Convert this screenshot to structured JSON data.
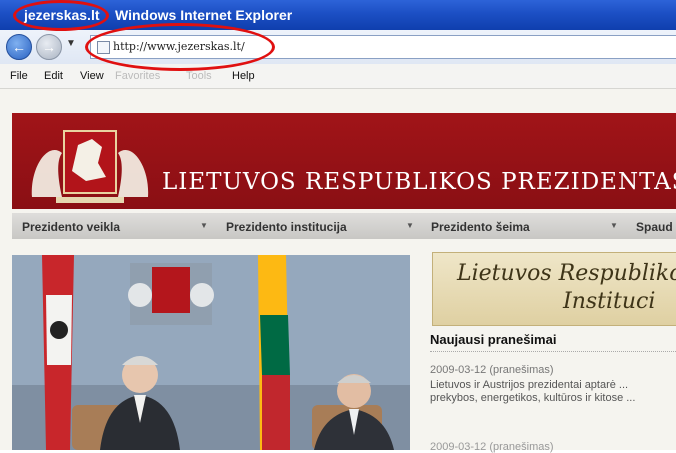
{
  "window": {
    "site_title": "jezerskas.lt",
    "app_title": "Windows Internet Explorer"
  },
  "address": {
    "url": "http://www.jezerskas.lt/"
  },
  "menu": [
    "File",
    "Edit",
    "View",
    "Favorites",
    "Tools",
    "Help"
  ],
  "banner": {
    "title": "LIETUVOS RESPUBLIKOS PREZIDENTAS"
  },
  "nav": {
    "items": [
      "Prezidento veikla",
      "Prezidento institucija",
      "Prezidento šeima",
      "Spaud"
    ]
  },
  "logo": {
    "line1": "Lietuvos Respubliko",
    "line2": "Instituci"
  },
  "news": {
    "heading": "Naujausi pranešimai",
    "date": "2009-03-12 (pranešimas)",
    "text": "Lietuvos ir Austrijos prezidentai aptarė ... prekybos, energetikos, kultūros ir kitose ...",
    "next_date": "2009-03-12 (pranešimas)"
  },
  "colors": {
    "titlebar": "#1c4fc4",
    "banner": "#a11418",
    "annotation": "#e01010",
    "nav": "#d4d3d0"
  }
}
